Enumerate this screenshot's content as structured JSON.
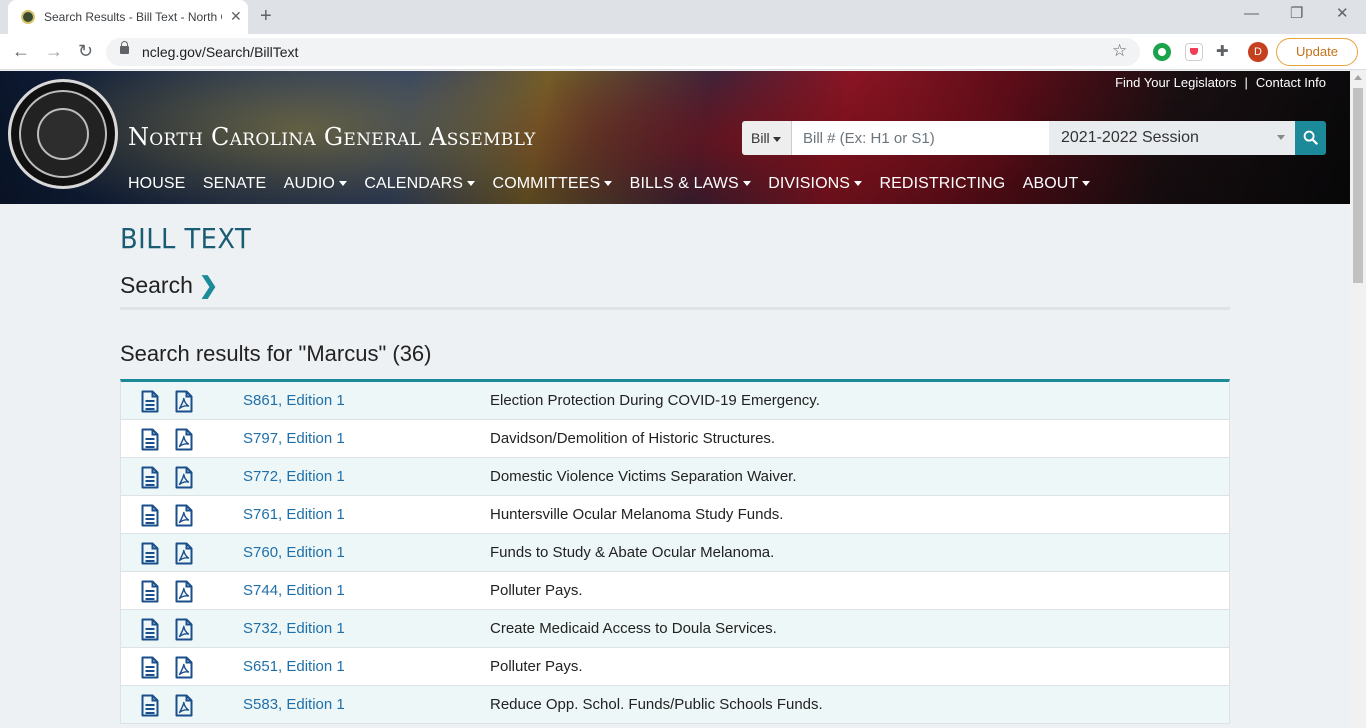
{
  "browser": {
    "tab_title": "Search Results - Bill Text - North Carolina General Assembly",
    "url": "ncleg.gov/Search/BillText",
    "avatar_letter": "D",
    "update_label": "Update"
  },
  "header": {
    "site_title": "North Carolina General Assembly",
    "top_links": [
      "Find Your Legislators",
      "Contact Info"
    ],
    "bill_type": "Bill",
    "bill_placeholder": "Bill # (Ex: H1 or S1)",
    "session": "2021-2022 Session",
    "nav": [
      {
        "label": "HOUSE",
        "dropdown": false
      },
      {
        "label": "SENATE",
        "dropdown": false
      },
      {
        "label": "AUDIO",
        "dropdown": true
      },
      {
        "label": "CALENDARS",
        "dropdown": true
      },
      {
        "label": "COMMITTEES",
        "dropdown": true
      },
      {
        "label": "BILLS & LAWS",
        "dropdown": true
      },
      {
        "label": "DIVISIONS",
        "dropdown": true
      },
      {
        "label": "REDISTRICTING",
        "dropdown": false
      },
      {
        "label": "ABOUT",
        "dropdown": true
      }
    ]
  },
  "main": {
    "page_title": "BILL TEXT",
    "search_label": "Search",
    "results_heading": "Search results for \"Marcus\" (36)",
    "results": [
      {
        "bill": "S861, Edition 1",
        "description": "Election Protection During COVID-19 Emergency."
      },
      {
        "bill": "S797, Edition 1",
        "description": "Davidson/Demolition of Historic Structures."
      },
      {
        "bill": "S772, Edition 1",
        "description": "Domestic Violence Victims Separation Waiver."
      },
      {
        "bill": "S761, Edition 1",
        "description": "Huntersville Ocular Melanoma Study Funds."
      },
      {
        "bill": "S760, Edition 1",
        "description": "Funds to Study & Abate Ocular Melanoma."
      },
      {
        "bill": "S744, Edition 1",
        "description": "Polluter Pays."
      },
      {
        "bill": "S732, Edition 1",
        "description": "Create Medicaid Access to Doula Services."
      },
      {
        "bill": "S651, Edition 1",
        "description": "Polluter Pays."
      },
      {
        "bill": "S583, Edition 1",
        "description": "Reduce Opp. Schol. Funds/Public Schools Funds."
      }
    ]
  },
  "colors": {
    "accent_teal": "#1d8a99",
    "title_blue": "#1a5c73",
    "link_blue": "#1f6fa8"
  }
}
